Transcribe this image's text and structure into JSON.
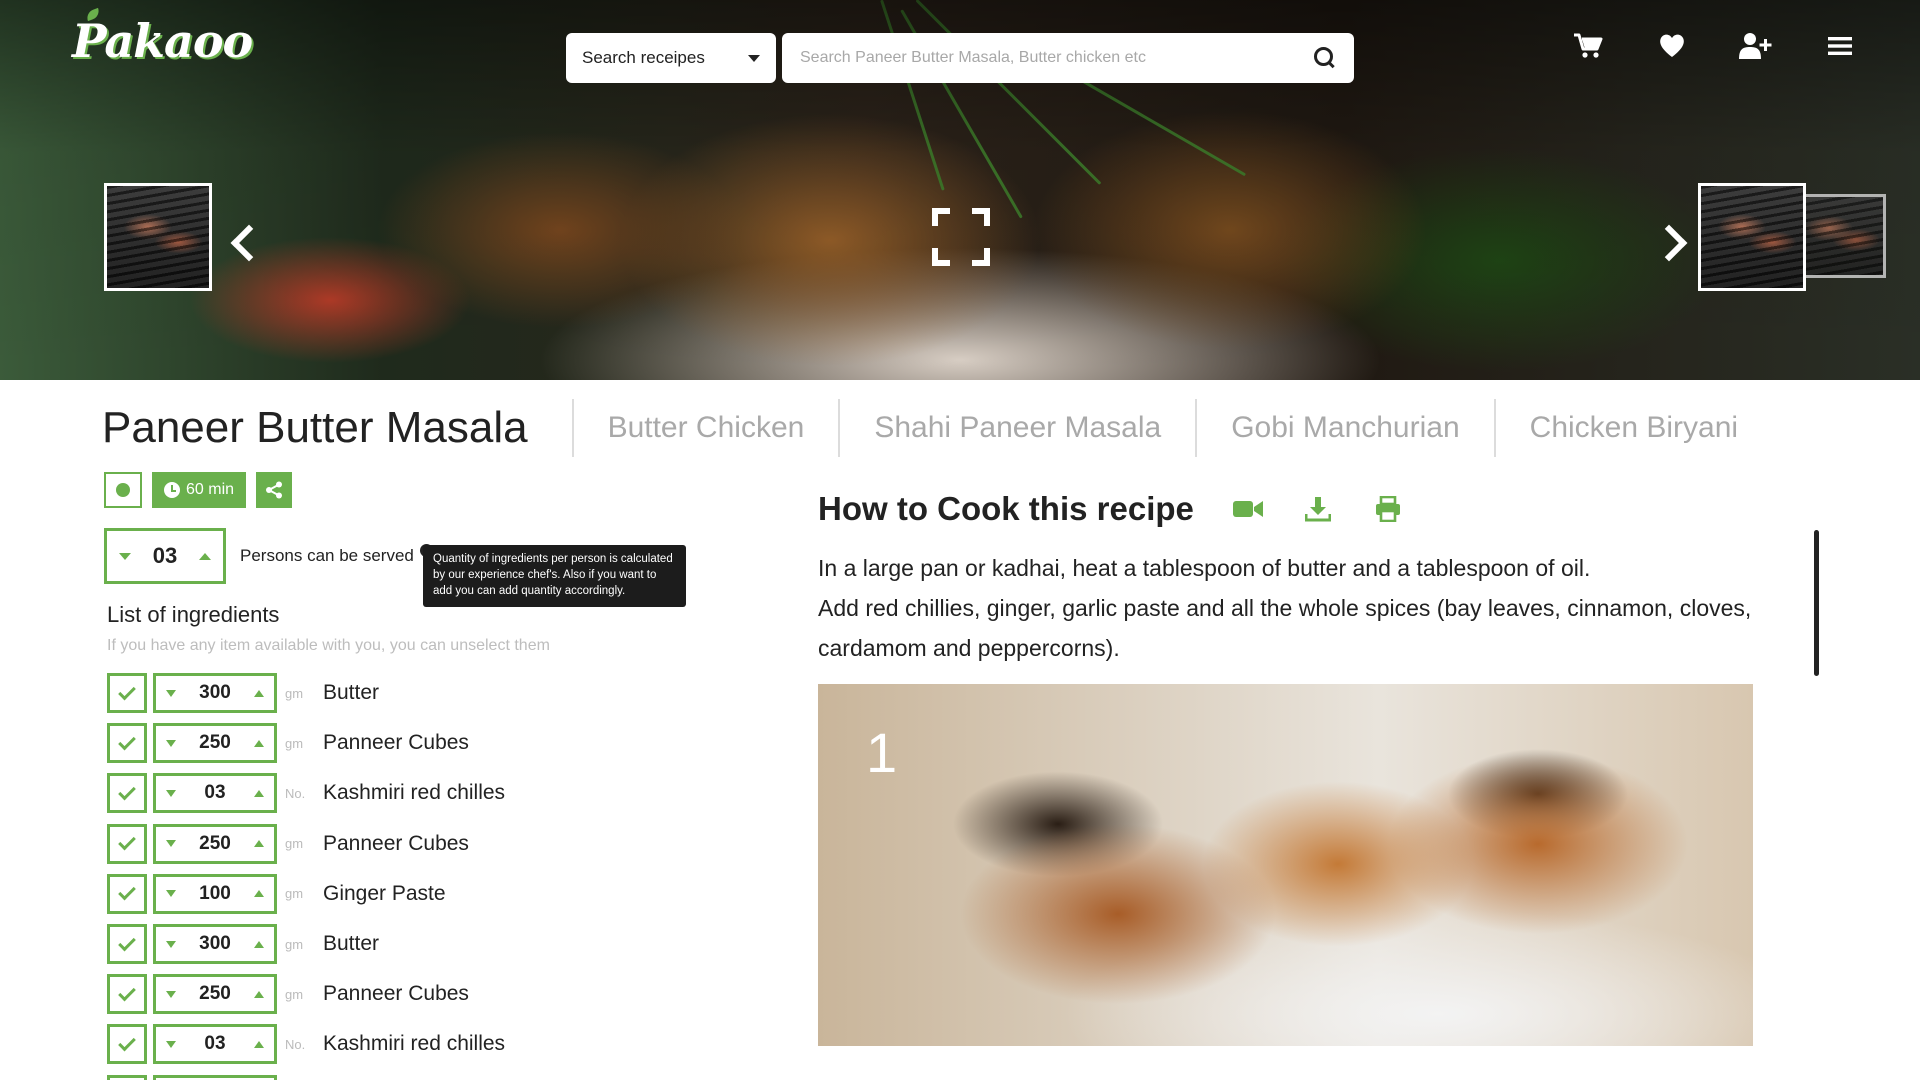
{
  "brand": {
    "logo_text": "Pakaoo"
  },
  "search": {
    "category_label": "Search receipes",
    "placeholder": "Search Paneer Butter Masala, Butter chicken etc"
  },
  "top_nav": {
    "icons": [
      "cart-icon",
      "heart-icon",
      "user-plus-icon",
      "menu-icon"
    ]
  },
  "hero": {
    "icons": [
      "chevron-left-icon",
      "fullscreen-icon",
      "chevron-right-icon"
    ]
  },
  "recipe_tabs": {
    "active": "Paneer Butter Masala",
    "others": [
      "Butter Chicken",
      "Shahi Paneer Masala",
      "Gobi Manchurian",
      "Chicken Biryani"
    ]
  },
  "meta": {
    "time_label": "60 min"
  },
  "servings": {
    "value": "03",
    "label": "Persons can be served",
    "info_glyph": "i",
    "tooltip": "Quantity of ingredients per person is calculated by our experience chef's. Also if you want to add you can add quantity accordingly."
  },
  "ingredients": {
    "title": "List of ingredients",
    "subtitle": "If you have any item available with you, you can unselect them",
    "items": [
      {
        "qty": "300",
        "unit": "gm",
        "name": "Butter"
      },
      {
        "qty": "250",
        "unit": "gm",
        "name": "Panneer Cubes"
      },
      {
        "qty": "03",
        "unit": "No.",
        "name": "Kashmiri red chilles"
      },
      {
        "qty": "250",
        "unit": "gm",
        "name": "Panneer Cubes"
      },
      {
        "qty": "100",
        "unit": "gm",
        "name": "Ginger Paste"
      },
      {
        "qty": "300",
        "unit": "gm",
        "name": "Butter"
      },
      {
        "qty": "250",
        "unit": "gm",
        "name": "Panneer Cubes"
      },
      {
        "qty": "03",
        "unit": "No.",
        "name": "Kashmiri red chilles"
      }
    ]
  },
  "cook": {
    "title": "How to Cook this recipe",
    "lines": [
      "In a large pan or kadhai, heat a tablespoon of butter and a tablespoon of oil.",
      "Add red chillies, ginger, garlic paste and all the whole spices (bay leaves, cinnamon, cloves, cardamom and peppercorns)."
    ],
    "step_number": "1"
  },
  "colors": {
    "accent": "#6ab04c",
    "text": "#222222",
    "muted": "#a9a9a9"
  }
}
